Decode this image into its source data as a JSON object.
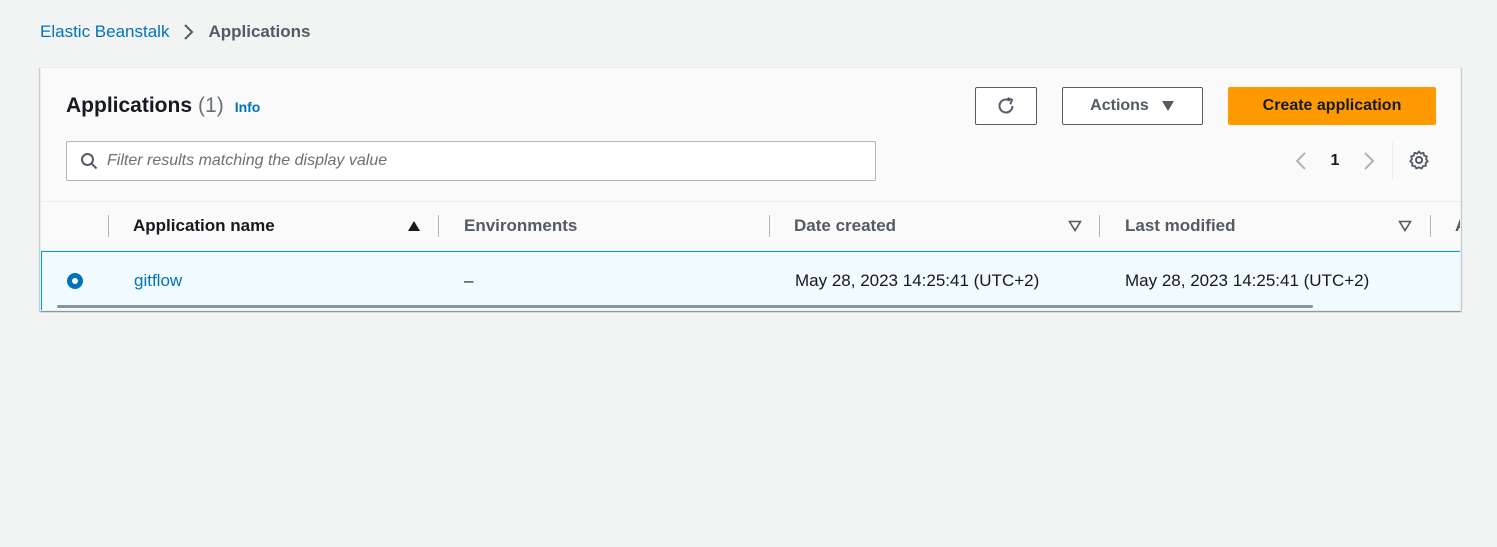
{
  "breadcrumb": {
    "service": "Elastic Beanstalk",
    "current": "Applications"
  },
  "panel": {
    "title": "Applications",
    "count": "(1)",
    "info_label": "Info"
  },
  "toolbar": {
    "refresh_icon": "refresh-icon",
    "actions_label": "Actions",
    "create_label": "Create application"
  },
  "filter": {
    "placeholder": "Filter results matching the display value",
    "value": ""
  },
  "pagination": {
    "current_page": "1"
  },
  "table": {
    "columns": [
      {
        "label": "Application name",
        "sort": "ascending"
      },
      {
        "label": "Environments",
        "sort": "none"
      },
      {
        "label": "Date created",
        "sort": "sortable"
      },
      {
        "label": "Last modified",
        "sort": "sortable"
      },
      {
        "label": "A",
        "sort": "none"
      }
    ],
    "rows": [
      {
        "selected": true,
        "name": "gitflow",
        "environments": "–",
        "date_created": "May 28, 2023 14:25:41 (UTC+2)",
        "last_modified": "May 28, 2023 14:25:41 (UTC+2)"
      }
    ]
  },
  "colors": {
    "accent_link": "#0073bb",
    "primary_button": "#ff9900",
    "selected_row_bg": "#f1faff",
    "selected_row_border": "#00a1c9",
    "page_bg": "#f2f3f3"
  }
}
